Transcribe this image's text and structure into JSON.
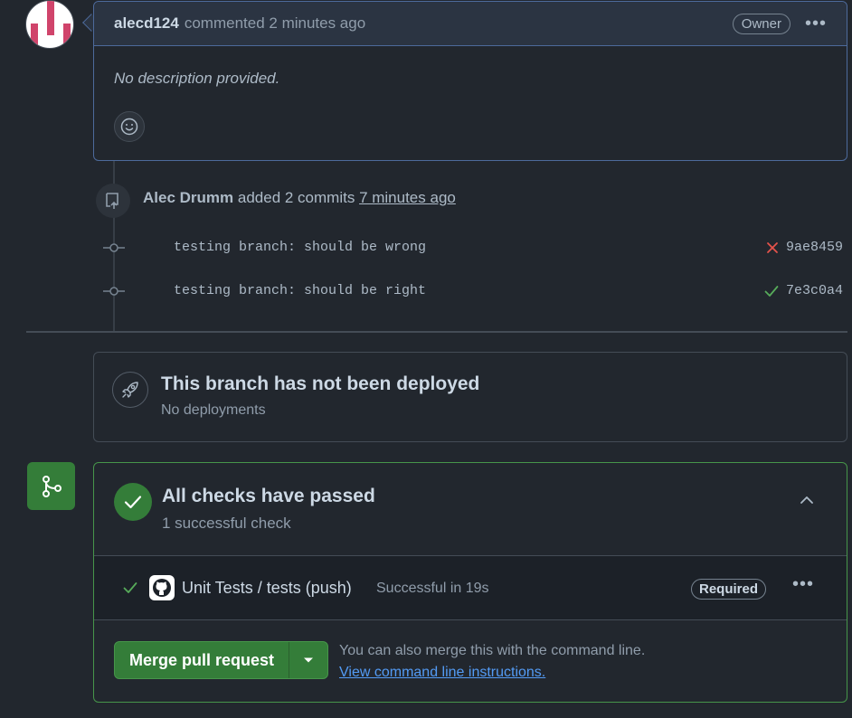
{
  "comment": {
    "author": "alecd124",
    "action": "commented 2 minutes ago",
    "badge": "Owner",
    "menu_icon": "kebab-horizontal-icon",
    "body": "No description provided.",
    "reaction_icon": "smiley-icon"
  },
  "commits_event": {
    "icon": "repo-push-icon",
    "actor": "Alec Drumm",
    "action": "added 2 commits",
    "time": "7 minutes ago",
    "commits": [
      {
        "message": "testing branch: should be wrong",
        "sha": "9ae8459",
        "status": "failure",
        "status_color": "#e5534b"
      },
      {
        "message": "testing branch: should be right",
        "sha": "7e3c0a4",
        "status": "success",
        "status_color": "#57ab5a"
      }
    ]
  },
  "deployment": {
    "icon": "rocket-icon",
    "title": "This branch has not been deployed",
    "subtitle": "No deployments"
  },
  "checks": {
    "icon": "git-merge-icon",
    "title": "All checks have passed",
    "subtitle": "1 successful check",
    "collapse_icon": "chevron-up-icon",
    "items": [
      {
        "name": "Unit Tests / tests (push)",
        "status": "Successful in 19s",
        "badge": "Required",
        "icon": "github-logo-icon"
      }
    ]
  },
  "merge": {
    "button_label": "Merge pull request",
    "dropdown_icon": "triangle-down-icon",
    "hint": "You can also merge this with the command line.",
    "link": "View command line instructions."
  },
  "colors": {
    "background": "#22272e",
    "success": "#347d39",
    "failure": "#e5534b",
    "link": "#539bf5"
  }
}
